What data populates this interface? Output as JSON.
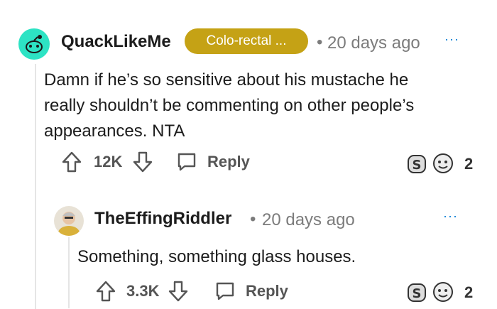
{
  "comment": {
    "username": "QuackLikeMe",
    "flair": "Colo-rectal ...",
    "separator": "•",
    "time": "20 days ago",
    "more": "···",
    "body": "Damn if he’s so sensitive about his mustache he really shouldn’t be commenting on other people’s appearances. NTA",
    "votes": "12K",
    "reply_label": "Reply",
    "award_count": "2"
  },
  "reply": {
    "username": "TheEffingRiddler",
    "separator": "•",
    "time": "20 days ago",
    "more": "···",
    "body": "Something, something glass houses.",
    "votes": "3.3K",
    "reply_label": "Reply",
    "award_count": "2"
  },
  "colors": {
    "flair_bg": "#c5a215",
    "avatar_bg": "#2de3c4",
    "more_dots": "#0079d3"
  },
  "icons": [
    "reddit-avatar-icon",
    "upvote-icon",
    "downvote-icon",
    "reply-icon",
    "silver-award-icon",
    "wholesome-award-icon"
  ]
}
